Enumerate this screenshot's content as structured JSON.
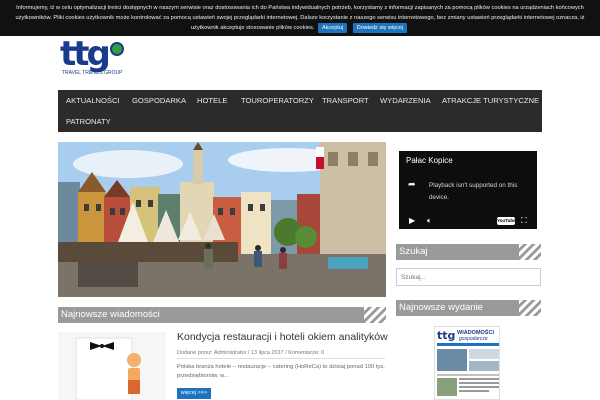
{
  "cookie_bar": {
    "text": "Informujemy, iż w celu optymalizacji treści dostępnych w naszym serwisie oraz dostosowania ich do Państwa indywidualnych potrzeb, korzystamy z informacji zapisanych za pomocą plików cookies na urządzeniach końcowych użytkowników. Pliki cookies użytkownik może kontrolować za pomocą ustawień swojej przeglądarki internetowej. Dalsze korzystanie z naszego serwisu internetowego, bez zmiany ustawień przeglądarki internetowej oznacza, iż użytkownik akceptuje stosowanie plików cookies.",
    "accept_label": "Akceptuj",
    "more_label": "Dowiedz się więcej"
  },
  "logo": {
    "text": "ttg",
    "subtitle": "TRAVEL TRENDS GROUP"
  },
  "nav": {
    "items": [
      "AKTUALNOŚCI",
      "GOSPODARKA",
      "HOTELE",
      "TOUROPERATORZY",
      "TRANSPORT",
      "WYDARZENIA",
      "ATRAKCJE TURYSTYCZNE",
      "PATRONATY"
    ]
  },
  "sections": {
    "latest_news": "Najnowsze wiadomości",
    "search": "Szukaj",
    "latest_issue": "Najnowsze wydanie"
  },
  "article": {
    "title": "Kondycja restauracji i hoteli okiem analityków",
    "meta": "Dodane przez: Administrator / 13 lipca 2017 / Komentarze: 0",
    "excerpt": "Polska branża hotele – restauracje – catering (HoReCa) to dzisiaj ponad 100 tys. przedsiębiorstw, w...",
    "more_label": "więcej >>>"
  },
  "video": {
    "title": "Pałac Kopice",
    "message": "Playback isn't supported on this device.",
    "yt_label": "YouTube"
  },
  "search": {
    "placeholder": "Szukaj..."
  },
  "newspaper": {
    "brand_top": "ttg",
    "brand_wiad": "WIADOMOŚCI",
    "brand_gosp": "gospodarcze"
  },
  "colors": {
    "nav_bg": "#2b2b2b",
    "section_head_bg": "#9a9a9a",
    "accent_blue": "#1e73be",
    "cookie_bg": "#111111"
  }
}
